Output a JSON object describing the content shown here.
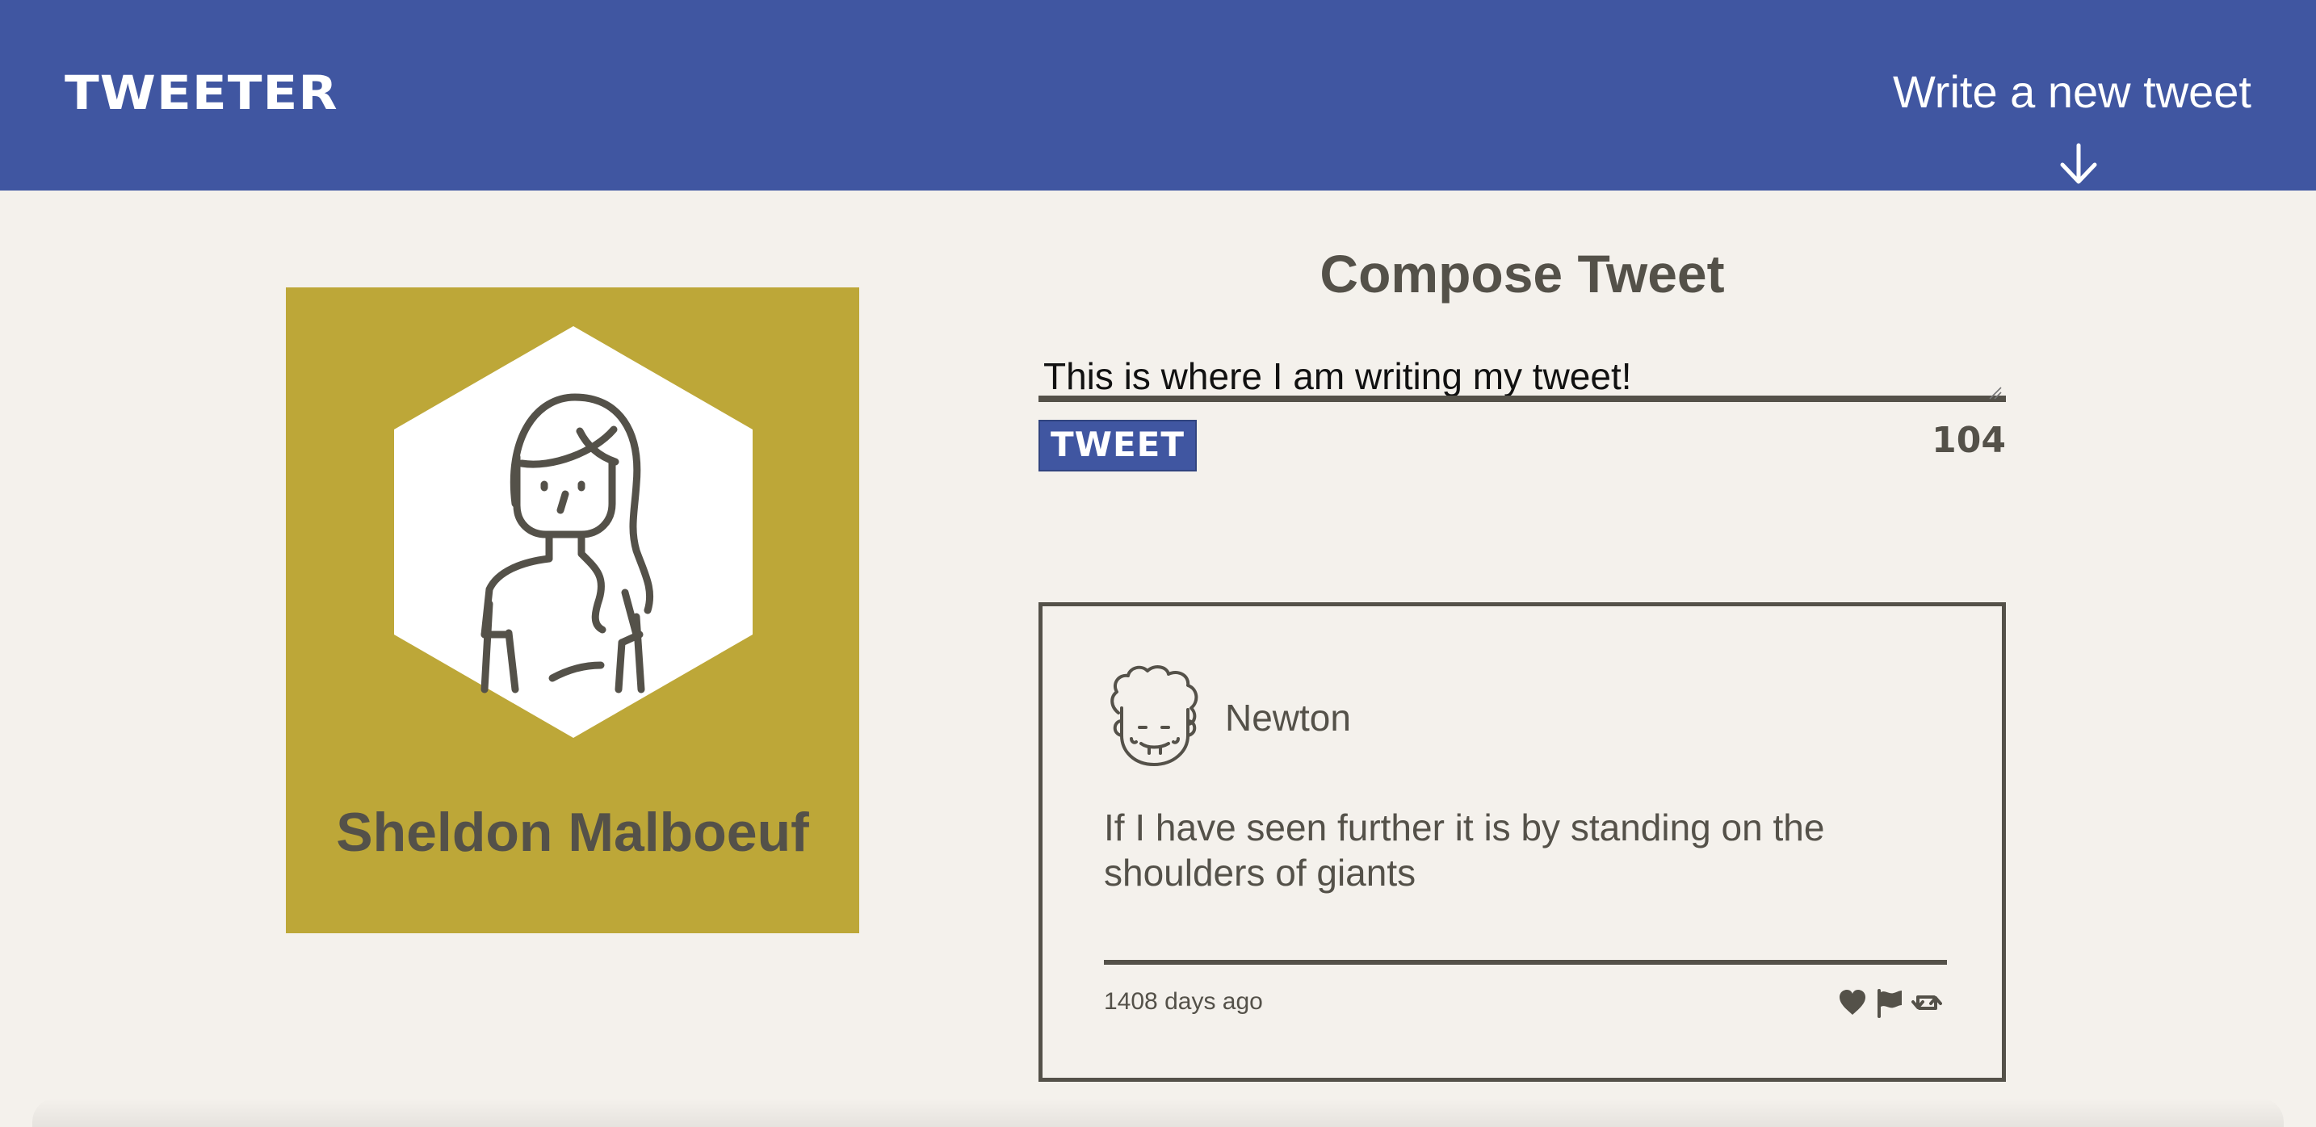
{
  "nav": {
    "logo": "TWEETER",
    "compose_link": "Write a new tweet",
    "arrow_icon": "arrow-down-icon",
    "background_color": "#4056a1"
  },
  "profile": {
    "name": "Sheldon Malboeuf",
    "avatar_icon": "user-avatar-icon",
    "background_color": "#bda738"
  },
  "compose": {
    "title": "Compose Tweet",
    "input_value": "This is where I am writing my tweet!",
    "button_label": "TWEET",
    "char_counter": "104"
  },
  "tweets": [
    {
      "author": "Newton",
      "avatar_icon": "curly-hair-avatar-icon",
      "body": "If I have seen further it is by standing on the shoulders of giants",
      "time": "1408 days ago",
      "actions": [
        "heart-icon",
        "flag-icon",
        "retweet-icon"
      ]
    }
  ],
  "colors": {
    "page_background": "#f4f1ec",
    "text": "#545149",
    "accent": "#4056a1"
  }
}
